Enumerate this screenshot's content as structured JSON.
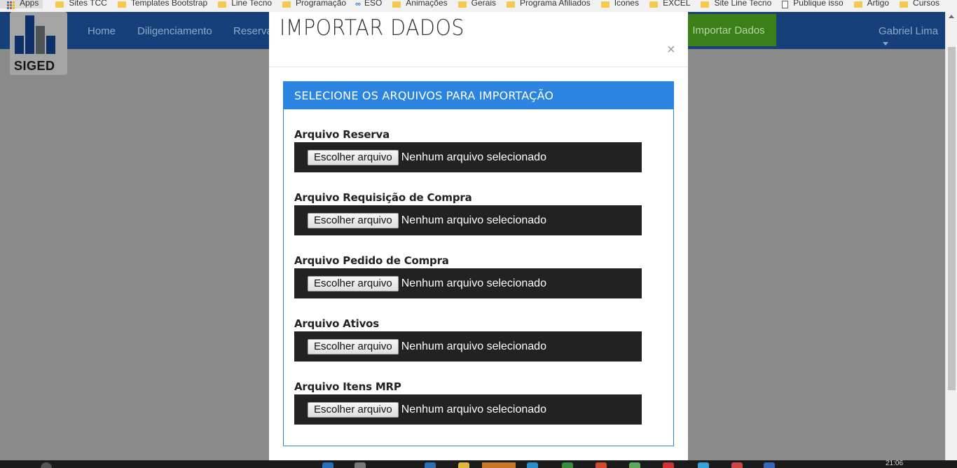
{
  "bookmarks": [
    {
      "label": "Apps",
      "icon": "apps-grid-icon"
    },
    {
      "label": "Sites TCC",
      "icon": "folder-icon"
    },
    {
      "label": "Templates Bootstrap",
      "icon": "folder-icon"
    },
    {
      "label": "Line Tecno",
      "icon": "folder-icon"
    },
    {
      "label": "Programação",
      "icon": "folder-icon"
    },
    {
      "label": "ESO",
      "icon": "eso-icon"
    },
    {
      "label": "Animações",
      "icon": "folder-icon"
    },
    {
      "label": "Gerais",
      "icon": "folder-icon"
    },
    {
      "label": "Programa Afiliados",
      "icon": "folder-icon"
    },
    {
      "label": "Icones",
      "icon": "folder-icon"
    },
    {
      "label": "EXCEL",
      "icon": "folder-icon"
    },
    {
      "label": "Site Line Tecno",
      "icon": "folder-icon"
    },
    {
      "label": "Publique isso",
      "icon": "page-icon"
    },
    {
      "label": "Artigo",
      "icon": "folder-icon"
    },
    {
      "label": "Cursos",
      "icon": "folder-icon"
    }
  ],
  "navbar": {
    "logo_text": "SIGED",
    "items": [
      "Home",
      "Diligenciamento",
      "Reserva"
    ],
    "active_item": "Importar Dados",
    "user": "Gabriel Lima"
  },
  "modal": {
    "title": "IMPORTAR DADOS",
    "close_symbol": "×",
    "panel_title": "SELECIONE OS ARQUIVOS PARA IMPORTAÇÃO",
    "fields": [
      {
        "label": "Arquivo Reserva",
        "button": "Escolher arquivo",
        "status": "Nenhum arquivo selecionado"
      },
      {
        "label": "Arquivo Requisição de Compra",
        "button": "Escolher arquivo",
        "status": "Nenhum arquivo selecionado"
      },
      {
        "label": "Arquivo Pedido de Compra",
        "button": "Escolher arquivo",
        "status": "Nenhum arquivo selecionado"
      },
      {
        "label": "Arquivo Ativos",
        "button": "Escolher arquivo",
        "status": "Nenhum arquivo selecionado"
      },
      {
        "label": "Arquivo Itens MRP",
        "button": "Escolher arquivo",
        "status": "Nenhum arquivo selecionado"
      }
    ]
  },
  "taskbar": {
    "clock": "21:06"
  },
  "colors": {
    "panel_accent": "#2b84e0",
    "navbar": "#16407a",
    "active_nav": "#3a7f18",
    "file_box": "#222222"
  }
}
